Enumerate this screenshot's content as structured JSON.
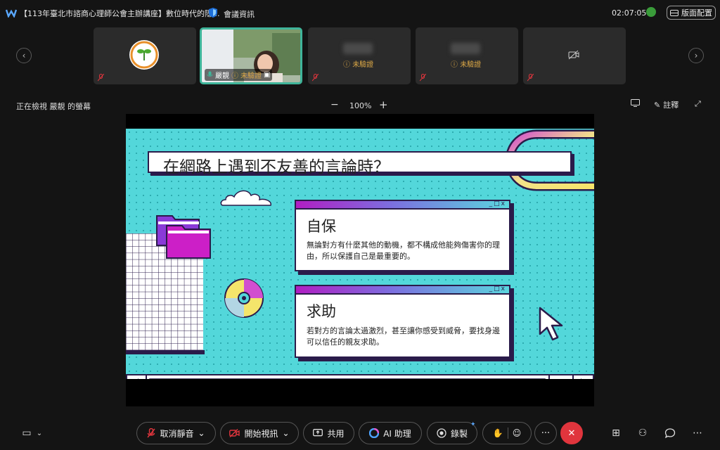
{
  "window": {
    "title": "【113年臺北市諮商心理師公會主辦講座】數位時代的隱...",
    "meeting_info": "會議資訊",
    "timer": "02:07:05",
    "layout_label": "版面配置"
  },
  "participants": [
    {
      "name": "",
      "status": ""
    },
    {
      "name": "嚴靚",
      "status": "未驗證"
    },
    {
      "name": "",
      "status": "未驗證"
    },
    {
      "name": "",
      "status": "未驗證"
    },
    {
      "name": "",
      "status": ""
    }
  ],
  "viewing": {
    "label": "正在檢視 嚴靚 的螢幕",
    "zoom": "100%",
    "minus": "−",
    "plus": "+",
    "annotate": "註釋"
  },
  "slide": {
    "title": "在網路上遇到不友善的言論時？",
    "cards": [
      {
        "heading": "自保",
        "body": "無論對方有什麼其他的動機，都不構成他能夠傷害你的理由，所以保護自己是最重要的。"
      },
      {
        "heading": "求助",
        "body": "若對方的言論太過激烈，甚至讓你感受到威脅，要找身邊可以信任的親友求助。"
      }
    ],
    "card_buttons": "_□x"
  },
  "toolbar": {
    "unmute": "取消靜音",
    "start_video": "開始視訊",
    "share": "共用",
    "ai": "AI 助理",
    "record": "錄製",
    "more": "···"
  },
  "colors": {
    "accent_teal": "#3fb59a",
    "slide_bg": "#53d7da",
    "leave_red": "#e0353d",
    "warning": "#d9a646"
  }
}
